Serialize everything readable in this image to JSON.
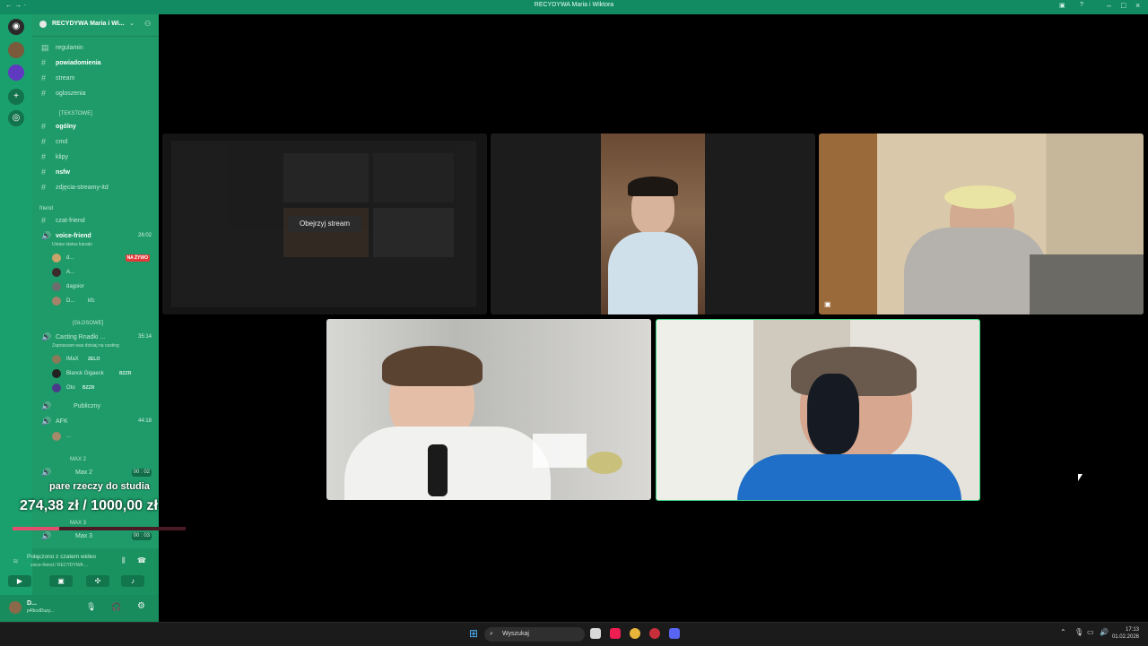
{
  "window": {
    "title": "RECYDYWA Maria i Wiktora",
    "nav": "← → ·"
  },
  "server": {
    "name": "RECYDYWA Maria i Wi..."
  },
  "channels_top": [
    {
      "label": "regulamin",
      "bold": false
    },
    {
      "label": "powiadomienia",
      "bold": true
    },
    {
      "label": "stream",
      "bold": false
    },
    {
      "label": "ogloszenia",
      "bold": false
    }
  ],
  "category_text": "[TEKSTOWE]",
  "channels_text": [
    {
      "label": "ogólny",
      "bold": true
    },
    {
      "label": "cmd",
      "bold": false
    },
    {
      "label": "klipy",
      "bold": false
    },
    {
      "label": "nsfw",
      "bold": true
    },
    {
      "label": "zdjęcia-streamy-itd",
      "bold": false
    }
  ],
  "category_friend": "friend",
  "channel_czat": "czat-friend",
  "voice_friend": {
    "label": "voice-friend",
    "time": "26:02",
    "status": "Ustaw status kanału"
  },
  "voice_friend_members": [
    {
      "name": "d...",
      "live": "NA ŻYWO"
    },
    {
      "name": "A..."
    },
    {
      "name": "dagsior"
    },
    {
      "name": "D...",
      "tag": "kfc"
    }
  ],
  "category_voice": "[GŁOSOWE]",
  "casting": {
    "label": "Casting Rnadki ...",
    "time": "35:14",
    "status": "Zapraszam was dzisiaj na casting"
  },
  "casting_members": [
    {
      "name": "iMaX",
      "tag": "ZELO"
    },
    {
      "name": "Blanck Gigaeck",
      "tag": "BZZR"
    },
    {
      "name": "Oto",
      "tag": "BZZR"
    }
  ],
  "publiczny": "Publiczny",
  "afk": {
    "label": "AFK",
    "time": "44:18"
  },
  "afk_member": "...",
  "category_max2": "MAX 2",
  "max2": {
    "label": "Max 2",
    "time": "00 : 02"
  },
  "category_max3": "MAX 3",
  "max3": {
    "label": "Max 3",
    "time": "00 : 03"
  },
  "voice_panel": {
    "status": "Połączono z czatem wideo",
    "channel": "voice-friend / RECYDYWA ..."
  },
  "user_panel": {
    "name": "D...",
    "sub": "p4lbcdDuzy..."
  },
  "overlay": {
    "title": "pare rzeczy do studia",
    "amount": "274,38 zł / 1000,00 zł",
    "progress": 0.27
  },
  "stream_tile": {
    "button": "Obejrzyj stream"
  },
  "taskbar": {
    "search": "Wyszukaj",
    "time": "17:13",
    "date": "01.02.2026"
  }
}
